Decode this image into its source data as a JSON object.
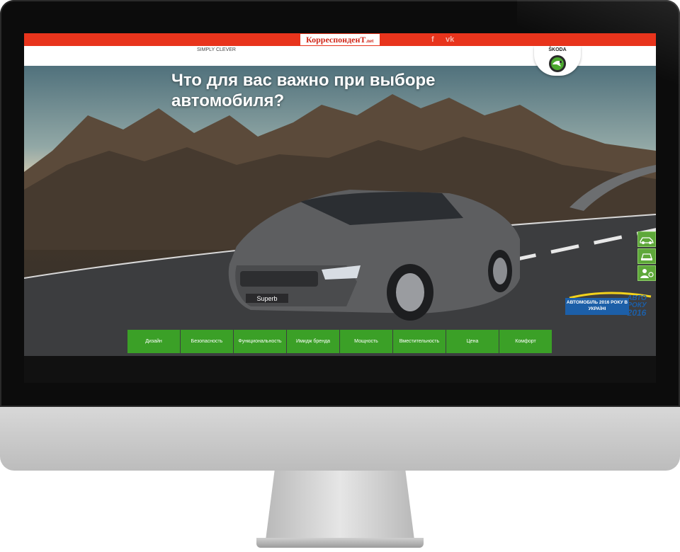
{
  "header": {
    "site_logo": "КорреспонденТ",
    "site_logo_suffix": ".net",
    "social": [
      "f",
      "vk"
    ],
    "slogan": "SIMPLY CLEVER",
    "brand": "ŠKODA"
  },
  "hero": {
    "headline": "Что для вас важно при выборе автомобиля?",
    "plate": "Superb",
    "award_text": "АВТОМОБІЛЬ 2016 РОКУ В УКРАЇНІ",
    "award_logo_line1": "АВТО",
    "award_logo_line2": "РОКУ",
    "award_logo_year": "2016"
  },
  "side_buttons": [
    "car-side-icon",
    "car-front-icon",
    "driver-icon"
  ],
  "nav": {
    "items": [
      "Дизайн",
      "Безопасность",
      "Функциональность",
      "Имидж бренда",
      "Мощность",
      "Вместительность",
      "Цена",
      "Комфорт"
    ]
  },
  "colors": {
    "topbar": "#e8341c",
    "nav": "#3ba027",
    "brand_green": "#4ba82e"
  }
}
